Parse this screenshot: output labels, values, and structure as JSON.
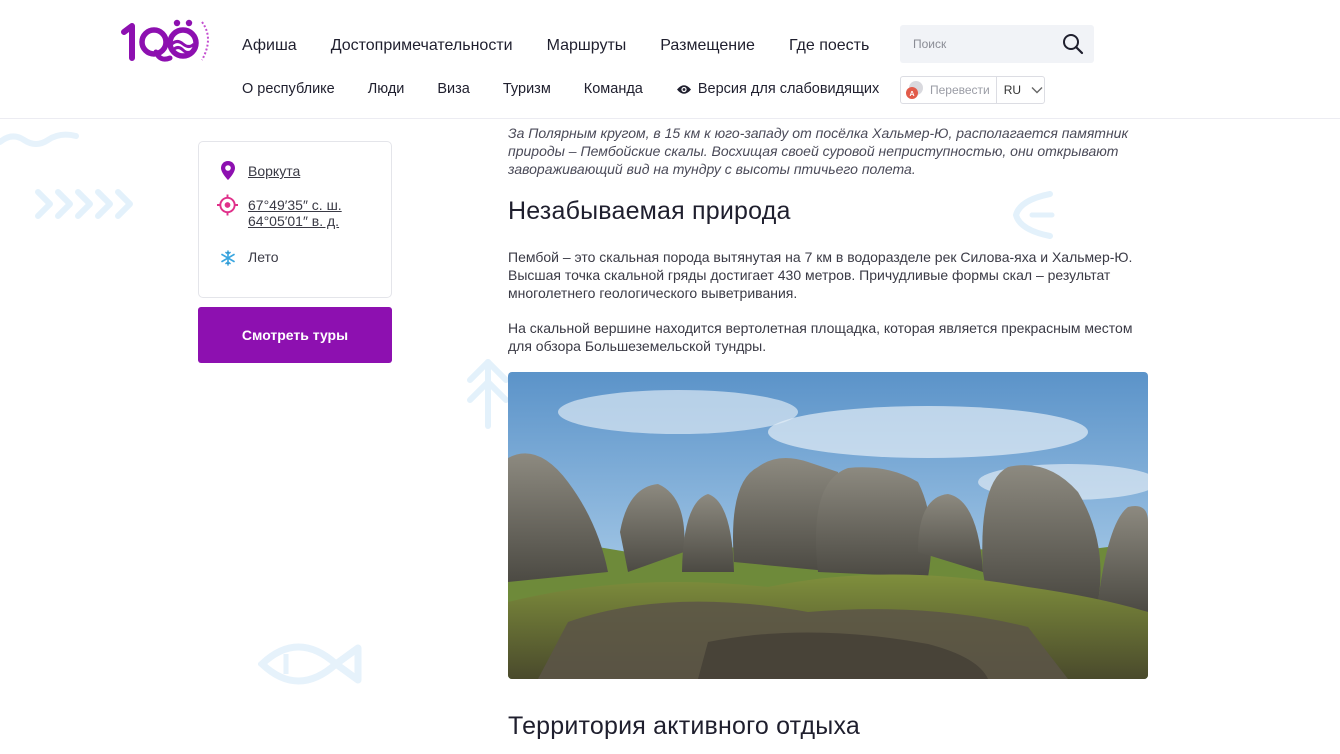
{
  "logo": {
    "alt": "Республика Коми 100"
  },
  "nav": {
    "main": [
      "Афиша",
      "Достопримечательности",
      "Маршруты",
      "Размещение",
      "Где поесть"
    ],
    "sub": [
      "О республике",
      "Люди",
      "Виза",
      "Туризм",
      "Команда"
    ],
    "vision_label": "Версия для слабовидящих"
  },
  "search": {
    "placeholder": "Поиск"
  },
  "translate": {
    "label": "Перевести",
    "lang": "RU"
  },
  "sidebar": {
    "city": "Воркута",
    "coord_lat": "67°49′35″ с. ш.",
    "coord_lon": "64°05′01″ в. д.",
    "season": "Лето",
    "tours_button": "Смотреть туры"
  },
  "content": {
    "lead": "За Полярным кругом, в 15 км к юго-западу от посёлка Хальмер-Ю, располагается памятник природы – Пембойские скалы. Восхищая своей суровой неприступностью, они открывают завораживающий вид на тундру с высоты птичьего полета.",
    "heading1": "Незабываемая природа",
    "paragraph1": "Пембой – это скальная порода вытянутая на 7 км в водоразделе рек Силова-яха и Хальмер-Ю. Высшая точка скальной гряды достигает 430 метров. Причудливые формы скал – результат многолетнего геологического выветривания.",
    "paragraph2": "На скальной вершине находится вертолетная площадка, которая является прекрасным местом для обзора Большеземельской тундры.",
    "heading2": "Территория активного отдыха"
  },
  "colors": {
    "accent": "#8d10b0",
    "pink": "#e0308a",
    "deco": "#e3f1fb"
  }
}
